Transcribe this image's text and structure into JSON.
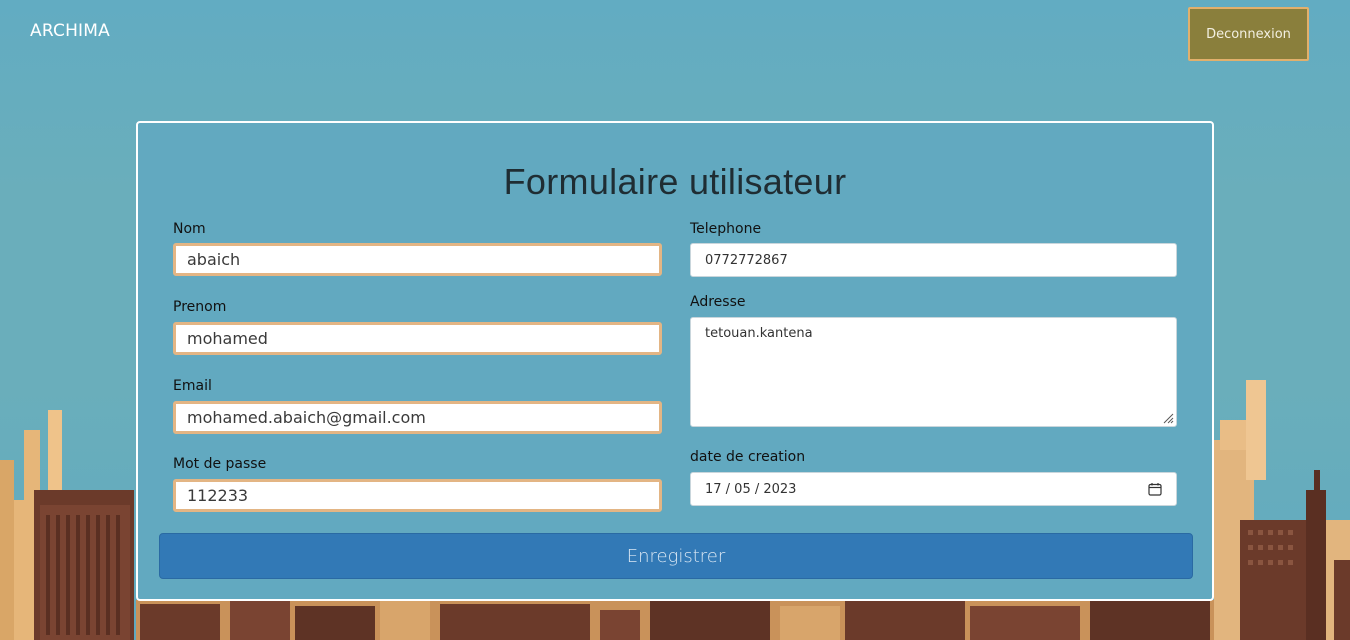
{
  "header": {
    "brand": "ARCHIMA",
    "logout_label": "Deconnexion"
  },
  "form": {
    "title": "Formulaire utilisateur",
    "fields": {
      "nom": {
        "label": "Nom",
        "value": "abaich"
      },
      "prenom": {
        "label": "Prenom",
        "value": "mohamed"
      },
      "email": {
        "label": "Email",
        "value": "mohamed.abaich@gmail.com"
      },
      "password": {
        "label": "Mot de passe",
        "value": "112233"
      },
      "telephone": {
        "label": "Telephone",
        "value": "0772772867"
      },
      "adresse": {
        "label": "Adresse",
        "value": "tetouan.kantena"
      },
      "date": {
        "label": "date de creation",
        "value": "17 / 05 / 2023"
      }
    },
    "submit_label": "Enregistrer"
  },
  "colors": {
    "background": "#62acc2",
    "card": "#62a9c0",
    "input_border": "#e3b584",
    "logout_button": "#8a7f3c",
    "submit_button": "#3279b6"
  },
  "icons": [
    "calendar-icon",
    "resize-grip-icon"
  ]
}
